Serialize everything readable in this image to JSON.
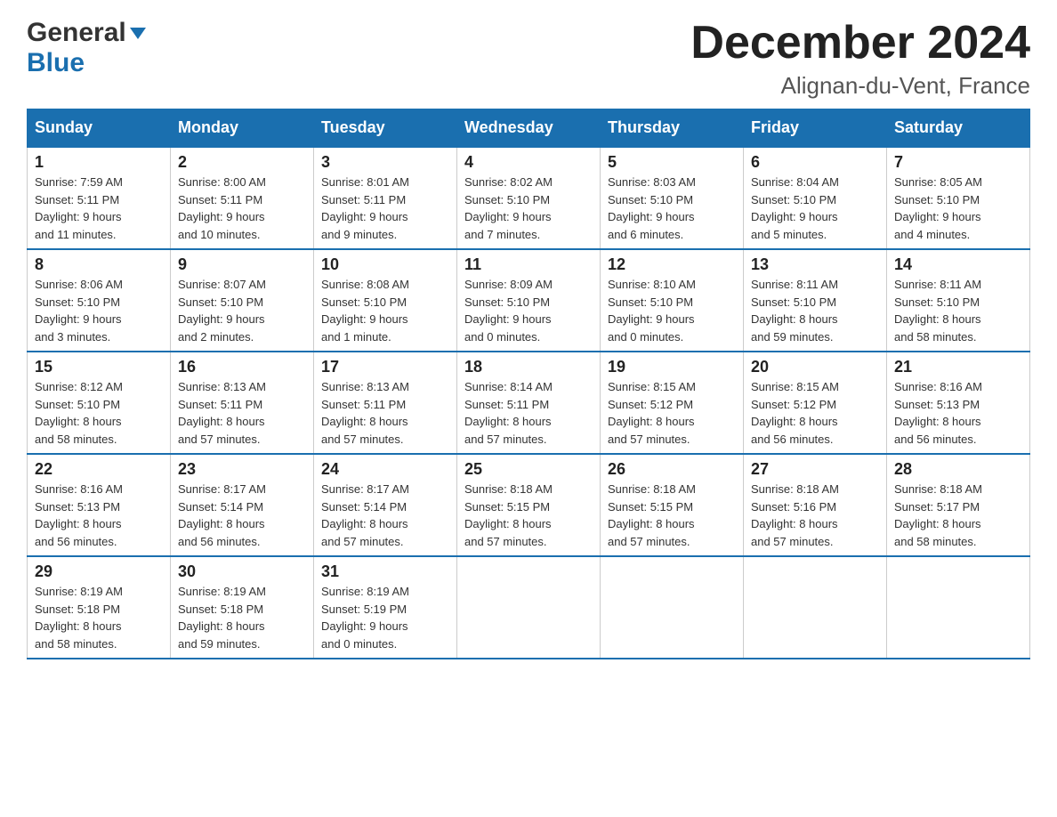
{
  "header": {
    "logo_general": "General",
    "logo_blue": "Blue",
    "month_title": "December 2024",
    "location": "Alignan-du-Vent, France"
  },
  "days_of_week": [
    "Sunday",
    "Monday",
    "Tuesday",
    "Wednesday",
    "Thursday",
    "Friday",
    "Saturday"
  ],
  "weeks": [
    [
      {
        "day": "1",
        "sunrise": "7:59 AM",
        "sunset": "5:11 PM",
        "daylight": "9 hours and 11 minutes."
      },
      {
        "day": "2",
        "sunrise": "8:00 AM",
        "sunset": "5:11 PM",
        "daylight": "9 hours and 10 minutes."
      },
      {
        "day": "3",
        "sunrise": "8:01 AM",
        "sunset": "5:11 PM",
        "daylight": "9 hours and 9 minutes."
      },
      {
        "day": "4",
        "sunrise": "8:02 AM",
        "sunset": "5:10 PM",
        "daylight": "9 hours and 7 minutes."
      },
      {
        "day": "5",
        "sunrise": "8:03 AM",
        "sunset": "5:10 PM",
        "daylight": "9 hours and 6 minutes."
      },
      {
        "day": "6",
        "sunrise": "8:04 AM",
        "sunset": "5:10 PM",
        "daylight": "9 hours and 5 minutes."
      },
      {
        "day": "7",
        "sunrise": "8:05 AM",
        "sunset": "5:10 PM",
        "daylight": "9 hours and 4 minutes."
      }
    ],
    [
      {
        "day": "8",
        "sunrise": "8:06 AM",
        "sunset": "5:10 PM",
        "daylight": "9 hours and 3 minutes."
      },
      {
        "day": "9",
        "sunrise": "8:07 AM",
        "sunset": "5:10 PM",
        "daylight": "9 hours and 2 minutes."
      },
      {
        "day": "10",
        "sunrise": "8:08 AM",
        "sunset": "5:10 PM",
        "daylight": "9 hours and 1 minute."
      },
      {
        "day": "11",
        "sunrise": "8:09 AM",
        "sunset": "5:10 PM",
        "daylight": "9 hours and 0 minutes."
      },
      {
        "day": "12",
        "sunrise": "8:10 AM",
        "sunset": "5:10 PM",
        "daylight": "9 hours and 0 minutes."
      },
      {
        "day": "13",
        "sunrise": "8:11 AM",
        "sunset": "5:10 PM",
        "daylight": "8 hours and 59 minutes."
      },
      {
        "day": "14",
        "sunrise": "8:11 AM",
        "sunset": "5:10 PM",
        "daylight": "8 hours and 58 minutes."
      }
    ],
    [
      {
        "day": "15",
        "sunrise": "8:12 AM",
        "sunset": "5:10 PM",
        "daylight": "8 hours and 58 minutes."
      },
      {
        "day": "16",
        "sunrise": "8:13 AM",
        "sunset": "5:11 PM",
        "daylight": "8 hours and 57 minutes."
      },
      {
        "day": "17",
        "sunrise": "8:13 AM",
        "sunset": "5:11 PM",
        "daylight": "8 hours and 57 minutes."
      },
      {
        "day": "18",
        "sunrise": "8:14 AM",
        "sunset": "5:11 PM",
        "daylight": "8 hours and 57 minutes."
      },
      {
        "day": "19",
        "sunrise": "8:15 AM",
        "sunset": "5:12 PM",
        "daylight": "8 hours and 57 minutes."
      },
      {
        "day": "20",
        "sunrise": "8:15 AM",
        "sunset": "5:12 PM",
        "daylight": "8 hours and 56 minutes."
      },
      {
        "day": "21",
        "sunrise": "8:16 AM",
        "sunset": "5:13 PM",
        "daylight": "8 hours and 56 minutes."
      }
    ],
    [
      {
        "day": "22",
        "sunrise": "8:16 AM",
        "sunset": "5:13 PM",
        "daylight": "8 hours and 56 minutes."
      },
      {
        "day": "23",
        "sunrise": "8:17 AM",
        "sunset": "5:14 PM",
        "daylight": "8 hours and 56 minutes."
      },
      {
        "day": "24",
        "sunrise": "8:17 AM",
        "sunset": "5:14 PM",
        "daylight": "8 hours and 57 minutes."
      },
      {
        "day": "25",
        "sunrise": "8:18 AM",
        "sunset": "5:15 PM",
        "daylight": "8 hours and 57 minutes."
      },
      {
        "day": "26",
        "sunrise": "8:18 AM",
        "sunset": "5:15 PM",
        "daylight": "8 hours and 57 minutes."
      },
      {
        "day": "27",
        "sunrise": "8:18 AM",
        "sunset": "5:16 PM",
        "daylight": "8 hours and 57 minutes."
      },
      {
        "day": "28",
        "sunrise": "8:18 AM",
        "sunset": "5:17 PM",
        "daylight": "8 hours and 58 minutes."
      }
    ],
    [
      {
        "day": "29",
        "sunrise": "8:19 AM",
        "sunset": "5:18 PM",
        "daylight": "8 hours and 58 minutes."
      },
      {
        "day": "30",
        "sunrise": "8:19 AM",
        "sunset": "5:18 PM",
        "daylight": "8 hours and 59 minutes."
      },
      {
        "day": "31",
        "sunrise": "8:19 AM",
        "sunset": "5:19 PM",
        "daylight": "9 hours and 0 minutes."
      },
      null,
      null,
      null,
      null
    ]
  ],
  "labels": {
    "sunrise_prefix": "Sunrise: ",
    "sunset_prefix": "Sunset: ",
    "daylight_prefix": "Daylight: "
  }
}
